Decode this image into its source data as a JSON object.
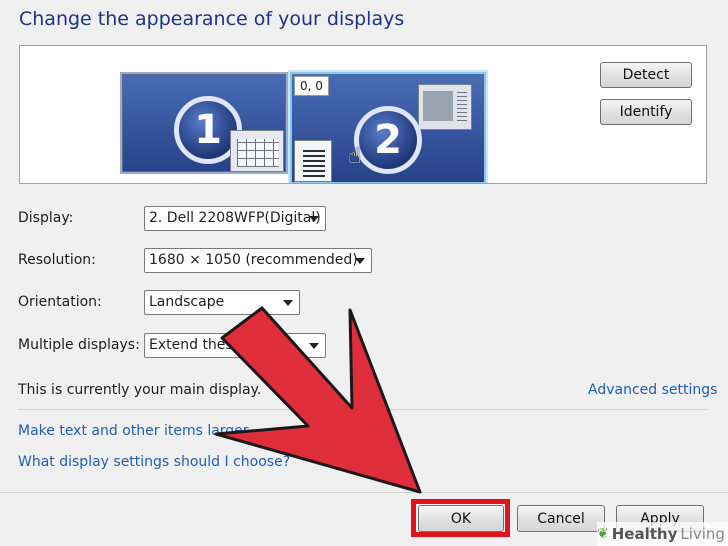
{
  "title": "Change the appearance of your displays",
  "preview": {
    "monitor1_number": "1",
    "monitor2_number": "2",
    "coords": "0, 0"
  },
  "buttons": {
    "detect": "Detect",
    "identify": "Identify",
    "ok": "OK",
    "cancel": "Cancel",
    "apply": "Apply"
  },
  "settings": {
    "display_label": "Display:",
    "display_value": "2. Dell 2208WFP(Digital)",
    "resolution_label": "Resolution:",
    "resolution_value": "1680 × 1050 (recommended)",
    "orientation_label": "Orientation:",
    "orientation_value": "Landscape",
    "multiple_label": "Multiple displays:",
    "multiple_value": "Extend these"
  },
  "main_display_text": "This is currently your main display.",
  "links": {
    "advanced": "Advanced settings",
    "text_size": "Make text and other items larger",
    "which_settings": "What display settings should I choose?"
  },
  "watermark": {
    "bold": "Healthy",
    "light": "Living"
  },
  "colors": {
    "title": "#1e3287",
    "link": "#1e5fb4",
    "highlight": "#e3131b",
    "arrow": "#e02d3c"
  }
}
